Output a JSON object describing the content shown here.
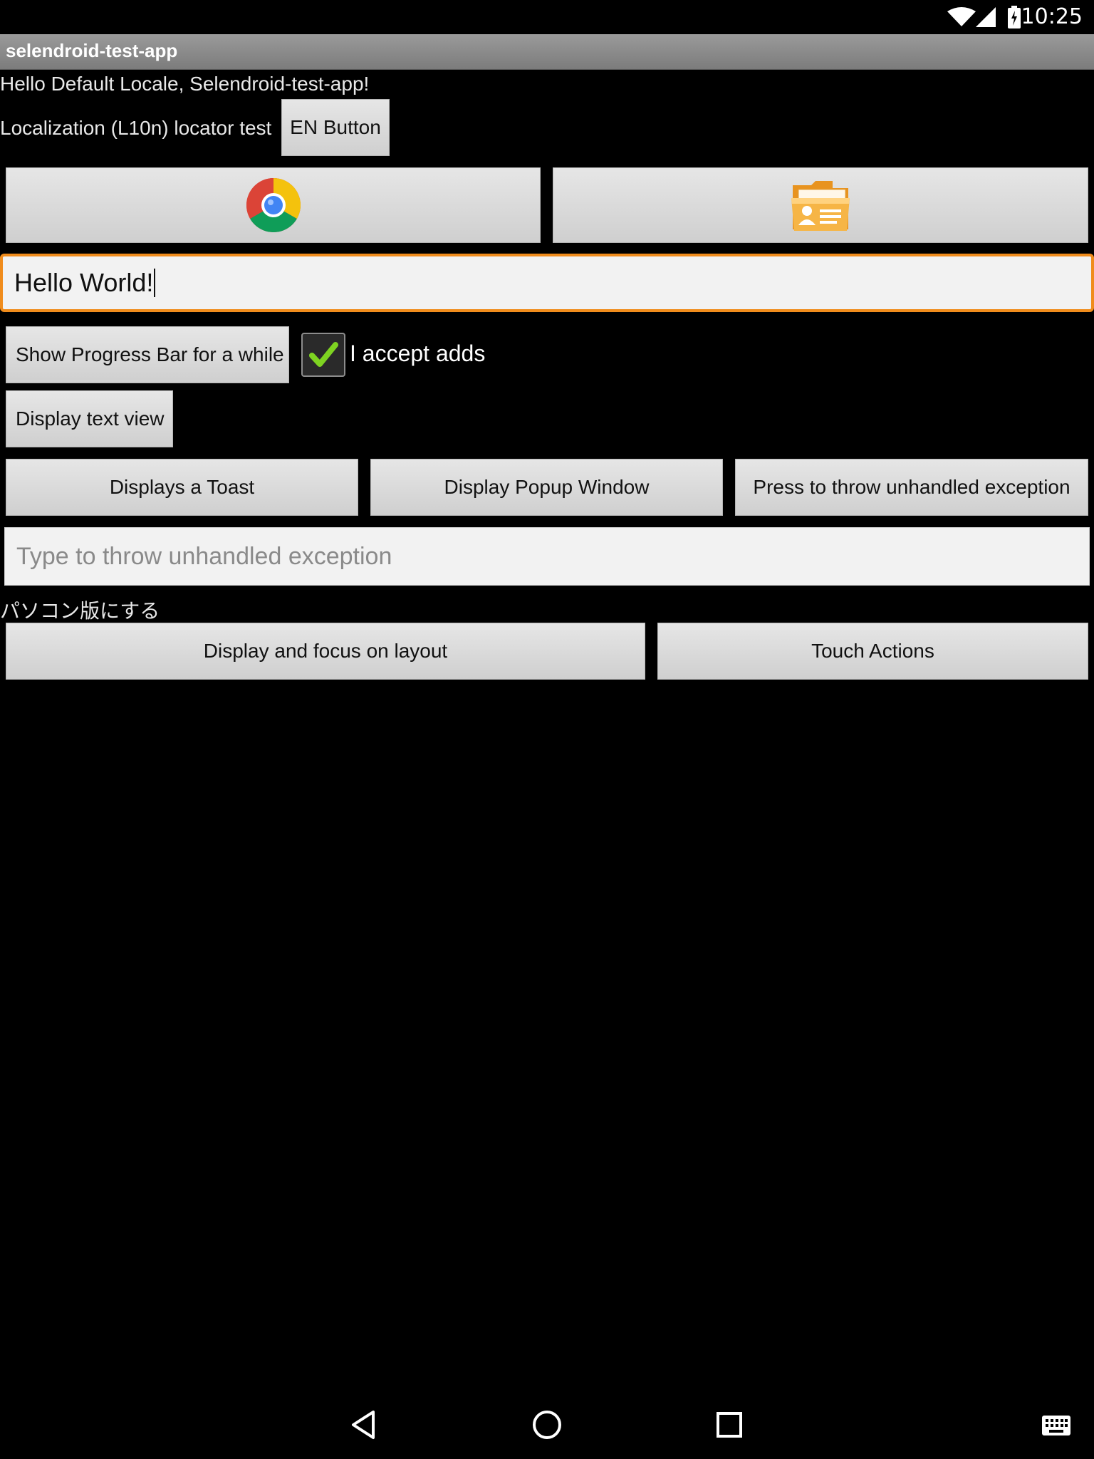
{
  "status": {
    "time": "10:25"
  },
  "app": {
    "title": "selendroid-test-app"
  },
  "greeting": "Hello Default Locale, Selendroid-test-app!",
  "l10n": {
    "label": "Localization (L10n) locator test",
    "button": "EN Button"
  },
  "image_buttons": {
    "left_icon": "chrome-icon",
    "right_icon": "contacts-folder-icon"
  },
  "main_input": {
    "value": "Hello World!"
  },
  "progress_button": "Show Progress Bar for a while",
  "checkbox": {
    "label": "I accept adds",
    "checked": true
  },
  "text_view_button": "Display text view",
  "action_buttons": [
    "Displays a Toast",
    "Display Popup Window",
    "Press to throw unhandled exception"
  ],
  "exception_input": {
    "placeholder": "Type to throw unhandled exception"
  },
  "japanese_text": "パソコン版にする",
  "bottom_buttons": [
    "Display and focus on layout",
    "Touch Actions"
  ],
  "colors": {
    "accent": "#f08c1c",
    "check": "#7ed321",
    "titlebar": "#8a8a8a"
  },
  "nav": {
    "icons": [
      "back-icon",
      "home-icon",
      "recents-icon",
      "keyboard-icon"
    ]
  }
}
